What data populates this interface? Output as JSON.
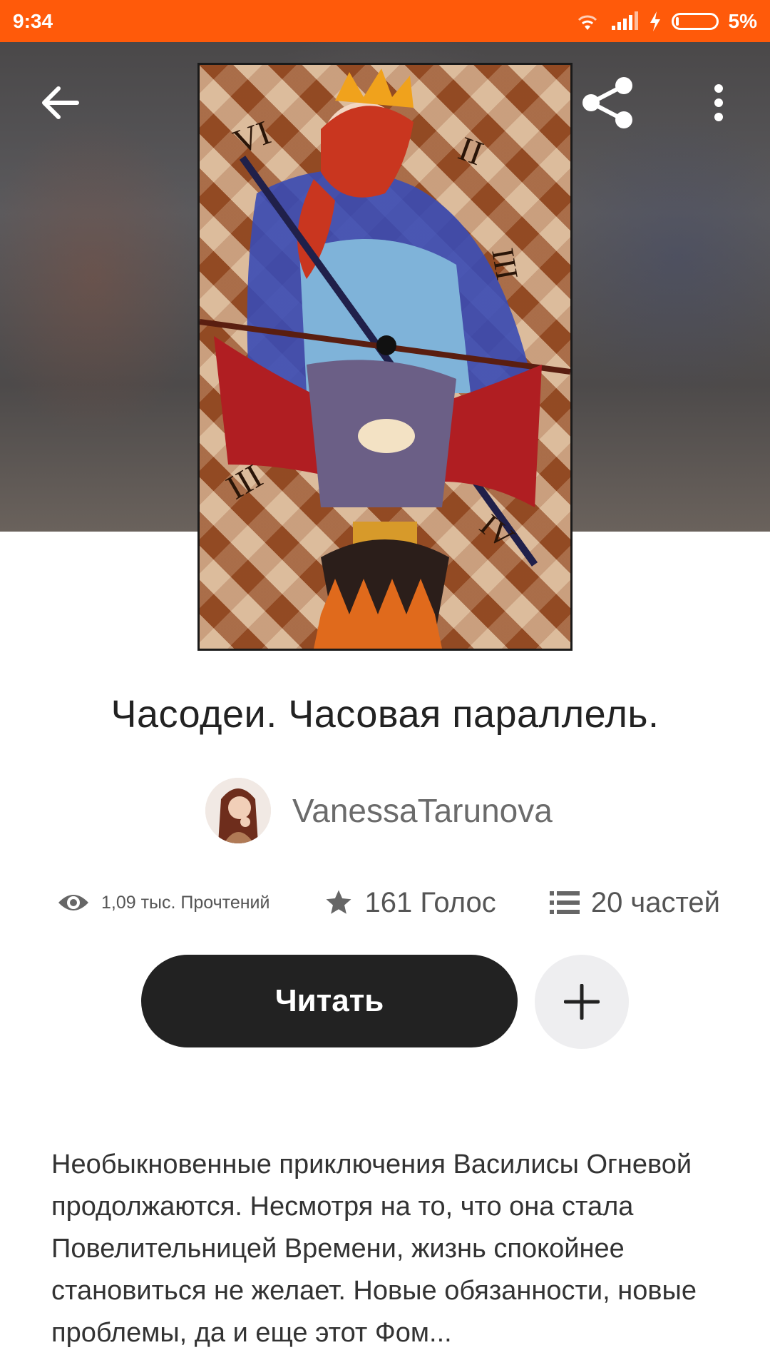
{
  "status_bar": {
    "time": "9:34",
    "battery": "5%",
    "icons": [
      "wifi-icon",
      "signal-icon",
      "charging-icon",
      "battery-icon"
    ],
    "color": "#ff5a0a"
  },
  "toolbar": {
    "back_icon": "arrow-left-icon",
    "share_icon": "share-icon",
    "menu_icon": "more-vertical-icon"
  },
  "story": {
    "title": "Часодеи. Часовая параллель.",
    "author": "VanessaTarunova",
    "reads": "1,09 тыс. Прочтений",
    "votes": "161 Голос",
    "parts": "20 частей",
    "read_label": "Читать",
    "description": "Необыкновенные приключения Василисы Огневой продолжаются. Несмотря на то, что она стала Повелительницей Времени, жизнь спокойнее становиться не желает. Новые обязанности, новые проблемы, да и еще этот Фом..."
  },
  "colors": {
    "accent": "#ff5a0a",
    "button_dark": "#222222",
    "add_button_bg": "#eeeef0"
  }
}
